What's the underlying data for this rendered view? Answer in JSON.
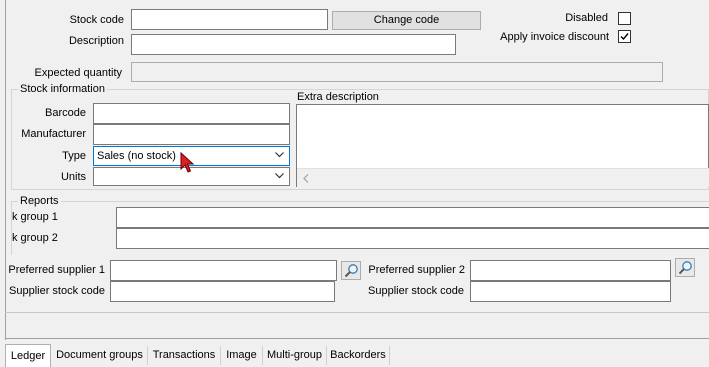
{
  "header": {
    "stock_code_label": "Stock code",
    "stock_code_value": "",
    "change_code_button": "Change code",
    "description_label": "Description",
    "description_value": "",
    "disabled_label": "Disabled",
    "disabled_checked": false,
    "apply_invoice_discount_label": "Apply invoice discount",
    "apply_invoice_discount_checked": true,
    "expected_quantity_label": "Expected quantity",
    "expected_quantity_value": ""
  },
  "stock_information": {
    "title": "Stock information",
    "barcode_label": "Barcode",
    "barcode_value": "",
    "manufacturer_label": "Manufacturer",
    "manufacturer_value": "",
    "type_label": "Type",
    "type_value": "Sales (no stock)",
    "units_label": "Units",
    "units_value": "",
    "extra_description_label": "Extra description",
    "extra_description_value": ""
  },
  "reports": {
    "title": "Reports",
    "group1_label": "k group 1",
    "group1_value": "",
    "group2_label": "k group 2",
    "group2_value": ""
  },
  "suppliers": {
    "preferred_supplier_1_label": "Preferred supplier 1",
    "preferred_supplier_1_value": "",
    "supplier_stock_code_1_label": "Supplier stock code",
    "supplier_stock_code_1_value": "",
    "preferred_supplier_2_label": "Preferred supplier 2",
    "preferred_supplier_2_value": "",
    "supplier_stock_code_2_label": "Supplier stock code",
    "supplier_stock_code_2_value": ""
  },
  "tabs": [
    {
      "label": "Ledger",
      "active": true
    },
    {
      "label": "Document groups",
      "active": false
    },
    {
      "label": "Transactions",
      "active": false
    },
    {
      "label": "Image",
      "active": false
    },
    {
      "label": "Multi-group",
      "active": false
    },
    {
      "label": "Backorders",
      "active": false
    }
  ],
  "colors": {
    "window_bg": "#f0f0f0",
    "focus_border": "#0078d7",
    "cursor": "#e02020"
  }
}
